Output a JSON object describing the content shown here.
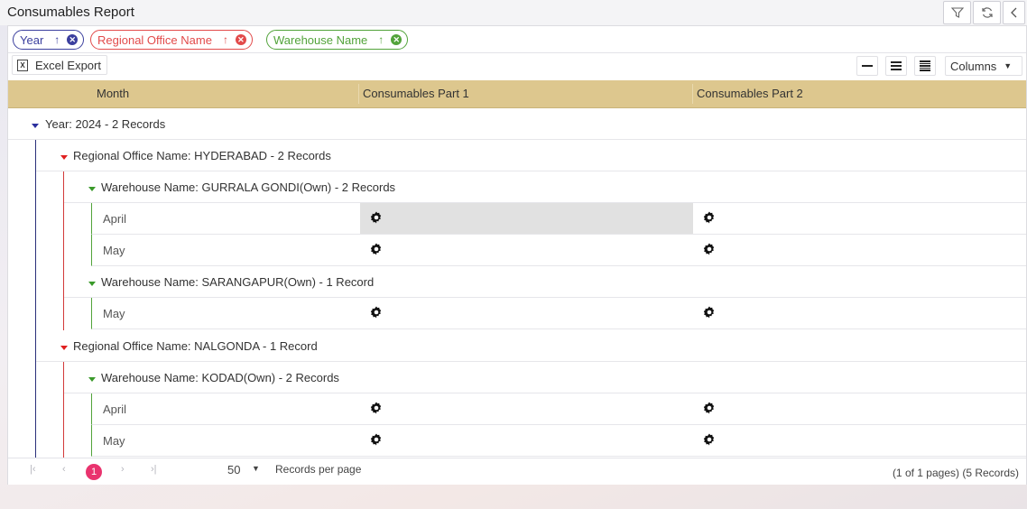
{
  "title": "Consumables Report",
  "toolbar_icons": [
    "filter-icon",
    "refresh-icon",
    "collapse-icon"
  ],
  "group_chips": [
    {
      "label": "Year",
      "color": "#3b3f9e"
    },
    {
      "label": "Regional Office Name",
      "color": "#e24a4a"
    },
    {
      "label": "Warehouse Name",
      "color": "#52a33a"
    }
  ],
  "actions": {
    "excel": "Excel Export",
    "columns": "Columns"
  },
  "columns": [
    "Month",
    "Consumables Part 1",
    "Consumables Part 2"
  ],
  "groups": {
    "year": "Year: 2024 - 2 Records",
    "ro_hyderabad": "Regional Office Name: HYDERABAD - 2 Records",
    "wh_gurrala": "Warehouse Name: GURRALA GONDI(Own) - 2 Records",
    "wh_sarangapur": "Warehouse Name: SARANGAPUR(Own) - 1 Record",
    "ro_nalgonda": "Regional Office Name: NALGONDA - 1 Record",
    "wh_kodad": "Warehouse Name: KODAD(Own) - 2 Records"
  },
  "rows": [
    {
      "month": "April"
    },
    {
      "month": "May"
    },
    {
      "month": "May"
    },
    {
      "month": "April"
    },
    {
      "month": "May"
    }
  ],
  "pager": {
    "current": "1",
    "page_size": "50",
    "page_size_label": "Records per page",
    "info": "(1 of 1 pages) (5 Records)"
  }
}
